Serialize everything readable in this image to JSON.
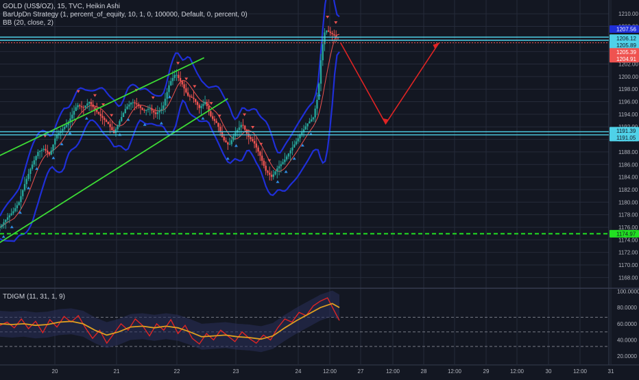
{
  "legend": {
    "symbol": "GOLD (US$/OZ), 15, TVC, Heikin Ashi",
    "strategy": "BarUpDn Strategy (1, percent_of_equity, 10, 1, 0, 100000, Default, 0, percent, 0)",
    "bb": "BB (20, close, 2)",
    "oscillator": "TDIGM (11, 31, 1, 9)"
  },
  "colors": {
    "background": "#131722",
    "grid": "#262b3a",
    "bull_candle": "#26a69a",
    "bear_candle": "#ef5350",
    "bollinger": "#1f2fd8",
    "channel": "#3ddc35",
    "horizontal_level": "#4fd1e8",
    "support": "#22e022",
    "projection_arrow": "#e02424",
    "oscillator_fast": "#e02424",
    "oscillator_slow": "#e0a020"
  },
  "chart_data": [
    {
      "type": "line",
      "subtype": "candlestick-heikin-ashi",
      "x_ticks": [
        "20",
        "21",
        "22",
        "23",
        "24",
        "12:00",
        "27",
        "12:00",
        "28",
        "12:00",
        "29",
        "12:00",
        "30",
        "12:00",
        "31"
      ],
      "y_ticks": [
        1168,
        1170,
        1172,
        1174,
        1176,
        1178,
        1180,
        1182,
        1184,
        1186,
        1188,
        1190,
        1192,
        1194,
        1196,
        1198,
        1200,
        1202,
        1204,
        1206,
        1208,
        1210
      ],
      "y_tick_labels": [
        "1168.00",
        "1170.00",
        "1172.00",
        "1174.00",
        "1176.00",
        "1178.00",
        "1180.00",
        "1182.00",
        "1184.00",
        "1186.00",
        "1188.00",
        "1190.00",
        "1192.00",
        "1194.00",
        "1196.00",
        "1198.00",
        "1200.00",
        "1202.00",
        "1204.00",
        "1206.00",
        "1208.00",
        "1210.00"
      ],
      "ylim": [
        1166.4,
        1212.2
      ],
      "price_path": [
        [
          0,
          1176
        ],
        [
          6,
          1177.5
        ],
        [
          11,
          1178.5
        ],
        [
          16,
          1180
        ],
        [
          21,
          1183
        ],
        [
          26,
          1185.5
        ],
        [
          32,
          1188
        ],
        [
          37,
          1188.5
        ],
        [
          42,
          1187.5
        ],
        [
          47,
          1190.5
        ],
        [
          52,
          1191.5
        ],
        [
          57,
          1192.5
        ],
        [
          61,
          1194
        ],
        [
          65,
          1195.5
        ],
        [
          70,
          1195
        ],
        [
          75,
          1196
        ],
        [
          81,
          1194.5
        ],
        [
          86,
          1193.5
        ],
        [
          91,
          1192.5
        ],
        [
          96,
          1191
        ],
        [
          101,
          1193
        ],
        [
          106,
          1195
        ],
        [
          111,
          1196
        ],
        [
          116,
          1195.5
        ],
        [
          121,
          1194.5
        ],
        [
          126,
          1195
        ],
        [
          131,
          1194
        ],
        [
          137,
          1195
        ],
        [
          143,
          1199
        ],
        [
          148,
          1200.5
        ],
        [
          153,
          1199
        ],
        [
          158,
          1197
        ],
        [
          163,
          1196.5
        ],
        [
          168,
          1195
        ],
        [
          173,
          1196
        ],
        [
          178,
          1193.5
        ],
        [
          183,
          1192.5
        ],
        [
          188,
          1190
        ],
        [
          193,
          1189
        ],
        [
          198,
          1191
        ],
        [
          204,
          1192.5
        ],
        [
          209,
          1190.5
        ],
        [
          214,
          1189.5
        ],
        [
          219,
          1187.5
        ],
        [
          224,
          1185
        ],
        [
          229,
          1184
        ],
        [
          234,
          1185.5
        ],
        [
          239,
          1186.5
        ],
        [
          244,
          1188
        ],
        [
          249,
          1189.5
        ],
        [
          254,
          1191
        ],
        [
          259,
          1192.5
        ],
        [
          264,
          1193.5
        ],
        [
          268,
          1197
        ],
        [
          271,
          1204
        ],
        [
          274,
          1207.5
        ],
        [
          278,
          1207
        ],
        [
          282,
          1206.5
        ],
        [
          286,
          1206
        ]
      ],
      "x_domain": [
        0,
        286
      ],
      "last_candle_index": 286,
      "horizontal_levels": [
        {
          "price": 1206.12,
          "label": "1206.12",
          "style": "cyan-double"
        },
        {
          "price": 1191.05,
          "label": "1191.05",
          "style": "cyan-double"
        },
        {
          "price": 1174.97,
          "label": "1174.97",
          "style": "dashed-green"
        },
        {
          "price": 1205.39,
          "style": "dotted-red"
        }
      ],
      "price_labels": [
        {
          "value": 1207.56,
          "text": "1207.56",
          "kind": "bb-upper"
        },
        {
          "value": 1206.12,
          "text": "1206.12",
          "kind": "level"
        },
        {
          "value": 1205.89,
          "text": "1205.89",
          "kind": "level-2"
        },
        {
          "value": 1205.39,
          "text": "1205.39",
          "kind": "last-red"
        },
        {
          "value": 1204.91,
          "text": "1204.91",
          "kind": "red"
        },
        {
          "value": 1191.39,
          "text": "1191.39",
          "kind": "level"
        },
        {
          "value": 1191.05,
          "text": "1191.05",
          "kind": "level-2"
        },
        {
          "value": 1174.97,
          "text": "1174.97",
          "kind": "support"
        }
      ],
      "channel_lines": [
        {
          "from": [
            -5,
            1187
          ],
          "to": [
            172,
            1203
          ]
        },
        {
          "from": [
            -5,
            1173
          ],
          "to": [
            192,
            1196.5
          ]
        }
      ],
      "projection": [
        [
          287,
          1205.4
        ],
        [
          325,
          1192.5
        ],
        [
          370,
          1205.4
        ]
      ]
    },
    {
      "type": "line",
      "name": "TDIGM (11, 31, 1, 9)",
      "y_ticks": [
        20,
        40,
        60,
        80,
        100
      ],
      "y_tick_labels": [
        "20.0000",
        "40.0000",
        "60.0000",
        "80.0000",
        "100.0000"
      ],
      "ylim": [
        10,
        103
      ],
      "dashed_levels": [
        68,
        50,
        32
      ],
      "fast_path": [
        [
          0,
          58
        ],
        [
          6,
          62
        ],
        [
          12,
          55
        ],
        [
          18,
          66
        ],
        [
          24,
          54
        ],
        [
          30,
          63
        ],
        [
          36,
          49
        ],
        [
          42,
          65
        ],
        [
          48,
          56
        ],
        [
          54,
          69
        ],
        [
          60,
          62
        ],
        [
          66,
          70
        ],
        [
          72,
          55
        ],
        [
          78,
          42
        ],
        [
          84,
          52
        ],
        [
          90,
          36
        ],
        [
          96,
          48
        ],
        [
          102,
          60
        ],
        [
          108,
          52
        ],
        [
          114,
          66
        ],
        [
          120,
          58
        ],
        [
          126,
          45
        ],
        [
          132,
          60
        ],
        [
          138,
          52
        ],
        [
          144,
          65
        ],
        [
          150,
          48
        ],
        [
          156,
          58
        ],
        [
          162,
          42
        ],
        [
          168,
          35
        ],
        [
          174,
          48
        ],
        [
          180,
          40
        ],
        [
          186,
          52
        ],
        [
          192,
          45
        ],
        [
          198,
          38
        ],
        [
          204,
          50
        ],
        [
          210,
          42
        ],
        [
          216,
          36
        ],
        [
          222,
          46
        ],
        [
          228,
          40
        ],
        [
          234,
          55
        ],
        [
          240,
          66
        ],
        [
          246,
          62
        ],
        [
          252,
          74
        ],
        [
          258,
          70
        ],
        [
          264,
          82
        ],
        [
          270,
          88
        ],
        [
          276,
          92
        ],
        [
          282,
          75
        ],
        [
          286,
          64
        ]
      ],
      "slow_path": [
        [
          0,
          60
        ],
        [
          10,
          59
        ],
        [
          20,
          60
        ],
        [
          30,
          58
        ],
        [
          40,
          59
        ],
        [
          50,
          62
        ],
        [
          60,
          63
        ],
        [
          70,
          60
        ],
        [
          80,
          52
        ],
        [
          90,
          46
        ],
        [
          100,
          50
        ],
        [
          110,
          56
        ],
        [
          120,
          57
        ],
        [
          130,
          55
        ],
        [
          140,
          57
        ],
        [
          150,
          55
        ],
        [
          160,
          50
        ],
        [
          170,
          44
        ],
        [
          180,
          45
        ],
        [
          190,
          46
        ],
        [
          200,
          44
        ],
        [
          210,
          43
        ],
        [
          220,
          41
        ],
        [
          230,
          45
        ],
        [
          240,
          55
        ],
        [
          250,
          64
        ],
        [
          260,
          72
        ],
        [
          270,
          80
        ],
        [
          280,
          85
        ],
        [
          286,
          80
        ]
      ]
    }
  ]
}
